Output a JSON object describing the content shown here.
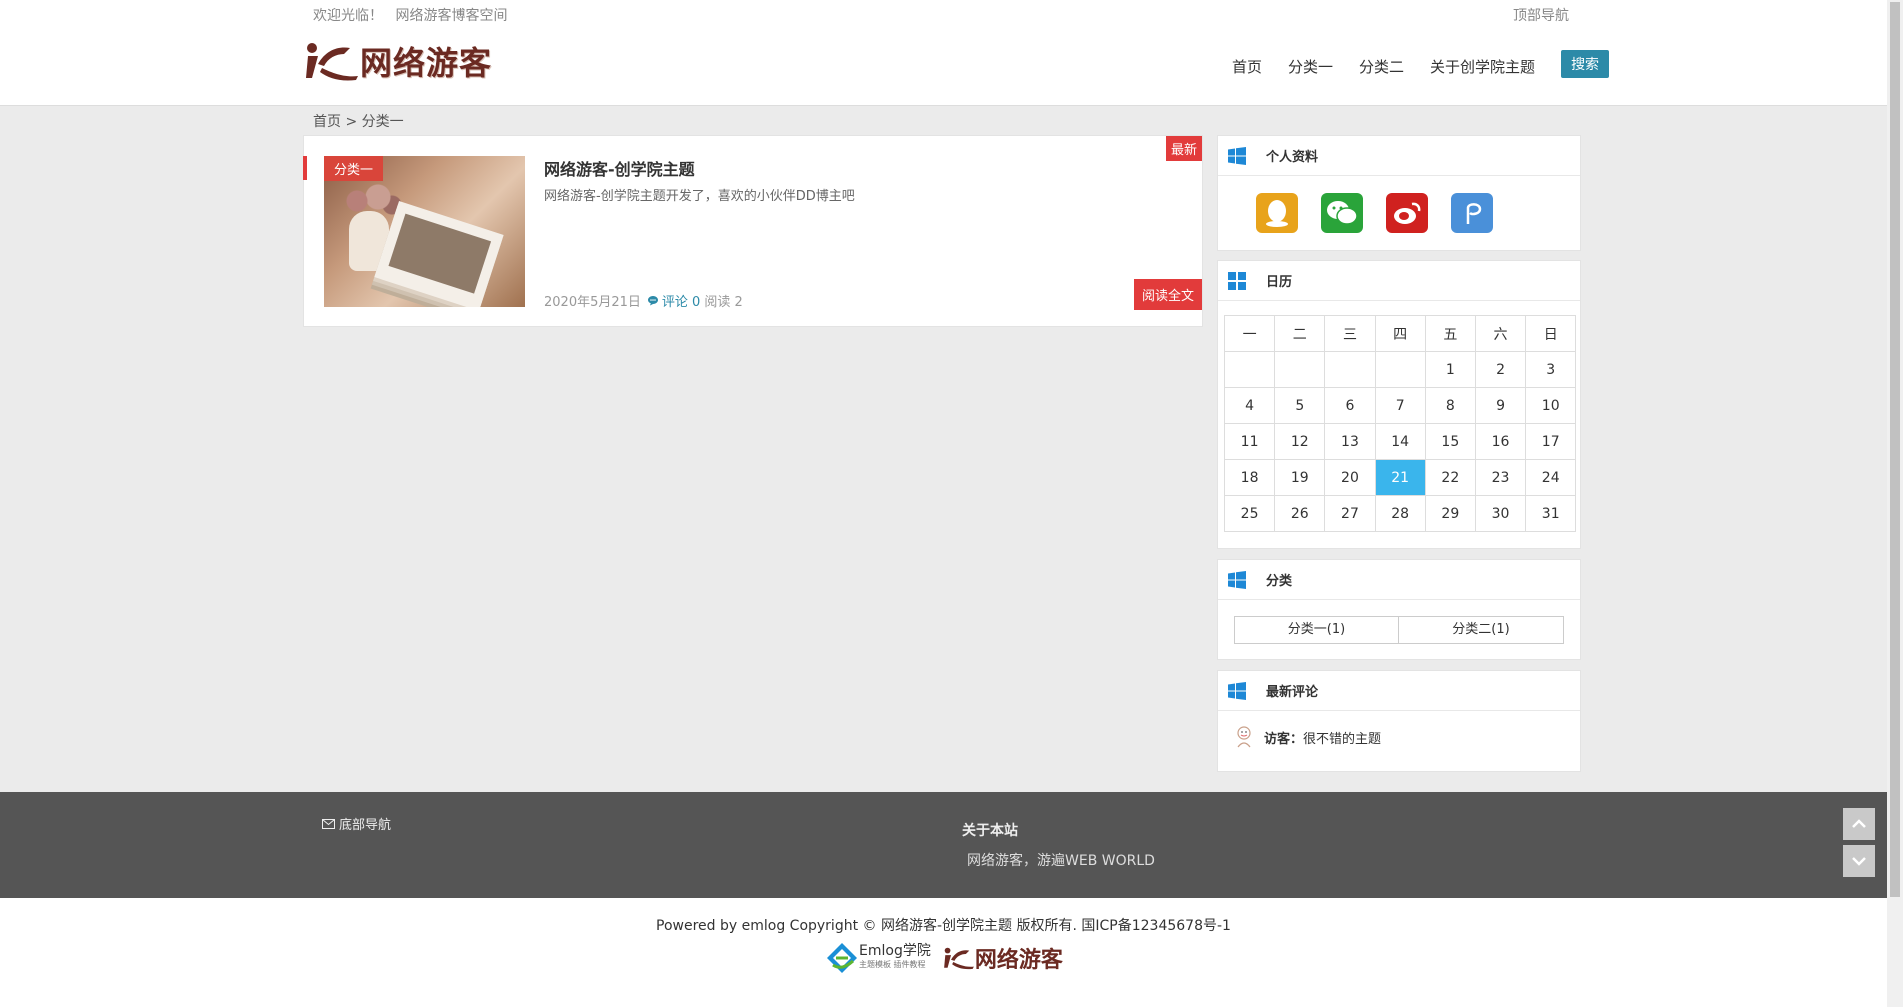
{
  "header": {
    "welcome": "欢迎光临！",
    "blog_space": "网络游客博客空间",
    "top_nav": "顶部导航",
    "logo_text": "网络游客",
    "nav": [
      "首页",
      "分类一",
      "分类二",
      "关于创学院主题"
    ],
    "search_label": "搜索"
  },
  "breadcrumb": {
    "home": "首页",
    "sep": ">",
    "current": "分类一"
  },
  "post": {
    "category": "分类一",
    "title": "网络游客-创学院主题",
    "description": "网络游客-创学院主题开发了，喜欢的小伙伴DD博主吧",
    "date": "2020年5月21日",
    "comments": "评论 0",
    "reads": "阅读 2",
    "new_tag": "最新",
    "read_more": "阅读全文"
  },
  "sidebar": {
    "profile_title": "个人资料",
    "socials": [
      "qq-icon",
      "wechat-icon",
      "weibo-icon",
      "pay-icon"
    ],
    "calendar_title": "日历",
    "calendar_head": [
      "一",
      "二",
      "三",
      "四",
      "五",
      "六",
      "日"
    ],
    "calendar_rows": [
      [
        "",
        "",
        "",
        "",
        "1",
        "2",
        "3"
      ],
      [
        "4",
        "5",
        "6",
        "7",
        "8",
        "9",
        "10"
      ],
      [
        "11",
        "12",
        "13",
        "14",
        "15",
        "16",
        "17"
      ],
      [
        "18",
        "19",
        "20",
        "21",
        "22",
        "23",
        "24"
      ],
      [
        "25",
        "26",
        "27",
        "28",
        "29",
        "30",
        "31"
      ]
    ],
    "calendar_today": "21",
    "category_title": "分类",
    "categories": [
      "分类一(1)",
      "分类二(1)"
    ],
    "comments_title": "最新评论",
    "comment_author": "访客：",
    "comment_text": "很不错的主题"
  },
  "footer": {
    "bottom_nav": "底部导航",
    "about_title": "关于本站",
    "about_text": "网络游客，游遍WEB WORLD",
    "copyright": "Powered by emlog Copyright ©  网络游客-创学院主题  版权所有. 国ICP备12345678号-1",
    "emlog_logo": "Emlog学院",
    "emlog_sub": "主题模板  插件教程",
    "logo_text": "网络游客"
  },
  "colors": {
    "accent_red": "#e23b3b",
    "accent_blue": "#2c8aa8",
    "today": "#3ab5ec",
    "footer_bg": "#555555"
  }
}
